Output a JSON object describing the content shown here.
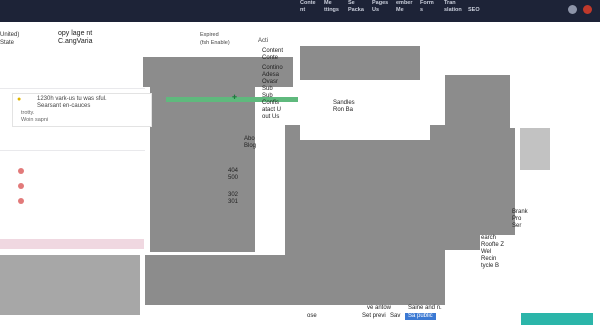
{
  "topbar": {
    "nav": [
      "Conte",
      "Me",
      "Se",
      "Pages",
      "ember",
      "Form",
      "Tran"
    ],
    "nav_sub": [
      "nt",
      "ttings",
      "Packa",
      "Us",
      "Me",
      "s",
      "slation",
      "SEO"
    ]
  },
  "header": {
    "country_line1": "United)",
    "country_line2": "State",
    "copy_label": "opy lage nt",
    "change_label": "C.angVaria",
    "expired_label": "Expired",
    "fb_enabled": "(fsh Enable)",
    "action": "Acti"
  },
  "notice": {
    "line1": "1230h vark-us tu was sful.",
    "line2": "Searsant en-cauces",
    "line3": "trotty.",
    "line4": "Woin sapni"
  },
  "menu": {
    "items": [
      "Content",
      "Conte",
      "Contino",
      "Adesa",
      "Ovasr",
      "Sub",
      "Sub",
      "Confis",
      "atact U",
      "out Us",
      "Abo",
      "Blog",
      "404",
      "500",
      "302",
      "301"
    ]
  },
  "right_panel": {
    "header_links": [
      "Sandles",
      "Ron Ba"
    ],
    "mid_items": [
      "Brank",
      "Pro",
      "Ser"
    ],
    "bottom_items": [
      "earch",
      "Roofte Z",
      "Wel",
      "Recin",
      "tycle B"
    ]
  },
  "bottom": {
    "left": "ose",
    "save_line1": "ve antow",
    "save_line2": "Saine and n.",
    "set_preview": "Set previ",
    "save": "Sav",
    "sale_publish": "Sa public"
  },
  "colors": {
    "topbar": "#1d2337",
    "gray": "#8c8c8c",
    "green": "#5fb97d",
    "teal": "#2bb5a9",
    "blue": "#3b79d3",
    "pink": "#f0d8e1"
  }
}
